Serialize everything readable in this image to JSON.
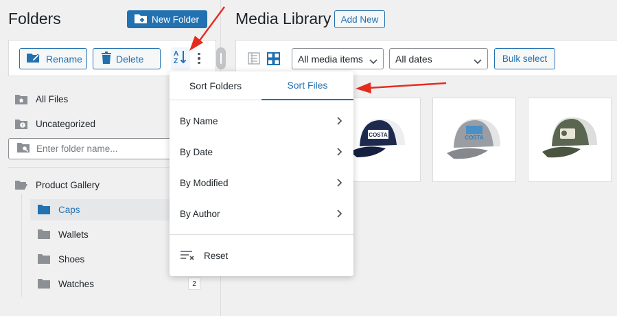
{
  "sidebar": {
    "title": "Folders",
    "new_folder_label": "New Folder",
    "toolbar": {
      "rename_label": "Rename",
      "delete_label": "Delete"
    },
    "all_files_label": "All Files",
    "uncategorized_label": "Uncategorized",
    "search_placeholder": "Enter folder name...",
    "parent_folder": "Product Gallery",
    "subfolders": [
      {
        "label": "Caps",
        "active": true
      },
      {
        "label": "Wallets"
      },
      {
        "label": "Shoes"
      },
      {
        "label": "Watches",
        "count": "2"
      }
    ]
  },
  "main": {
    "title": "Media Library",
    "add_new_label": "Add New",
    "filters": {
      "media_type": "All media items",
      "dates": "All dates"
    },
    "bulk_select_label": "Bulk select"
  },
  "sort_popup": {
    "tabs": [
      {
        "label": "Sort Folders"
      },
      {
        "label": "Sort Files",
        "active": true
      }
    ],
    "items": [
      "By Name",
      "By Date",
      "By Modified",
      "By Author"
    ],
    "reset_label": "Reset"
  },
  "media_items": [
    {
      "icon": "navy-cap-thumbnail",
      "logo_text": "COSTA"
    },
    {
      "icon": "grey-cap-thumbnail",
      "logo_text": "COSTA"
    },
    {
      "icon": "olive-cap-thumbnail"
    }
  ],
  "colors": {
    "accent": "#2271b1",
    "annotation": "#e62b1e",
    "background": "#f0f0f1"
  }
}
